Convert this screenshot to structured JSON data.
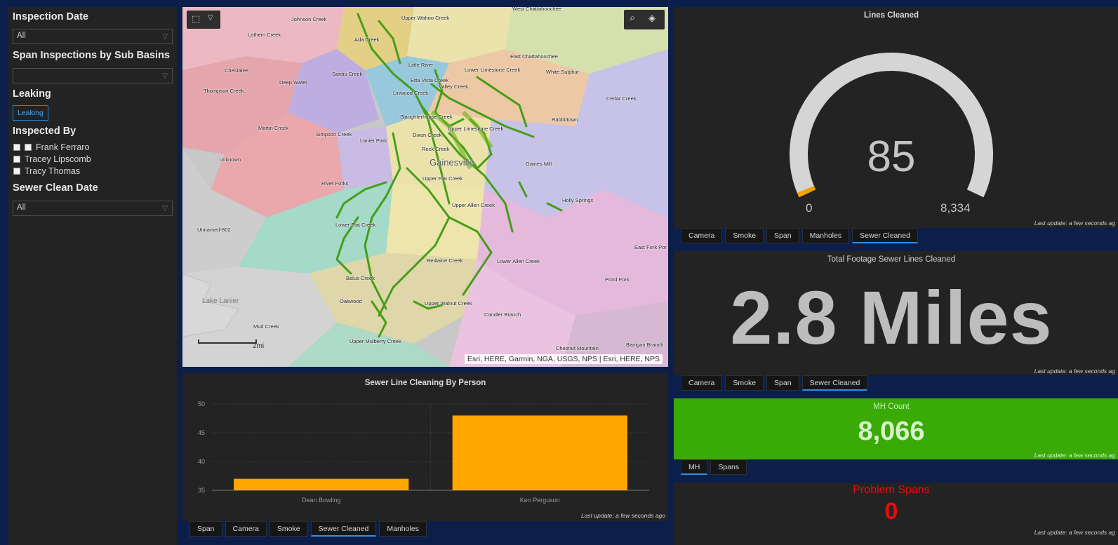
{
  "filters": {
    "inspection_date": {
      "title": "Inspection Date",
      "value": "All"
    },
    "span_inspections": {
      "title": "Span Inspections by Sub Basins",
      "value": ""
    },
    "leaking": {
      "title": "Leaking",
      "chip": "Leaking"
    },
    "inspected_by": {
      "title": "Inspected By",
      "people": [
        "Frank Ferraro",
        "Tracey Lipscomb",
        "Tracy Thomas"
      ]
    },
    "sewer_clean_date": {
      "title": "Sewer Clean Date",
      "value": "All"
    }
  },
  "map": {
    "attribution": "Esri, HERE, Garmin, NGA, USGS, NPS | Esri, HERE, NPS",
    "scale_label": "2mi",
    "city_label": "Gainesville",
    "lake_label": "Lake Lanier",
    "basin_labels": [
      "West Chattahoochee",
      "Johnson Creek",
      "Upper Wahoo Creek",
      "Lathem Creek",
      "Ada Creek",
      "East Chattahoochee",
      "Chestatee",
      "Sardis Creek",
      "Little River",
      "Lower Limestone Creek",
      "White Sulphur",
      "Deep Water",
      "Etta Vista Creek",
      "Valley Creek",
      "Thompson Creek",
      "Linwood Creek",
      "Cedar Creek",
      "Slaughterhouse Creek",
      "Rabbittown",
      "Martin Creek",
      "Upper Limestone Creek",
      "Simpson Creek",
      "Dixon Creek",
      "Lanier Park",
      "Rock Creek",
      "unknown",
      "Gaines Mill",
      "Upper Flat Creek",
      "River Forks",
      "Holly Springs",
      "Upper Allen Creek",
      "Unnamed-802",
      "Lower Flat Creek",
      "East Fork Por",
      "Redwine Creek",
      "Lower Allen Creek",
      "Balus Creek",
      "Pond Fork",
      "Oakwood",
      "Upper Walnut Creek",
      "Candler Branch",
      "Mud Creek",
      "Upper Mulberry Creek",
      "Chesnut Mountain",
      "Banigan Branch"
    ],
    "icons": {
      "toolbar_left": "select-icon",
      "toolbar_dropdown": "chevron-down-icon",
      "search": "search-icon",
      "layers": "layers-icon"
    }
  },
  "bar_chart_panel": {
    "title": "Sewer Line Cleaning By Person",
    "last_update": "Last update: a few seconds ago",
    "tabs": [
      "Span",
      "Camera",
      "Smoke",
      "Sewer Cleaned",
      "Manholes"
    ],
    "active_tab": "Sewer Cleaned"
  },
  "chart_data": {
    "type": "bar",
    "title": "Sewer Line Cleaning By Person",
    "categories": [
      "Dean Bowling",
      "Ken Perguson"
    ],
    "values": [
      37,
      48
    ],
    "ylim": [
      35,
      50
    ],
    "yticks": [
      35,
      40,
      45,
      50
    ],
    "bar_color": "#ffa600",
    "grid": true
  },
  "gauge": {
    "title": "Lines Cleaned",
    "value": "85",
    "value_num": 85,
    "min": "0",
    "min_num": 0,
    "max": "8,334",
    "max_num": 8334,
    "fill_color": "#f5a300",
    "last_update": "Last update: a few seconds ag",
    "tabs": [
      "Camera",
      "Smoke",
      "Span",
      "Manholes",
      "Sewer Cleaned"
    ],
    "active_tab": "Sewer Cleaned"
  },
  "footage": {
    "title": "Total Footage Sewer Lines Cleaned",
    "value": "2.8 Miles",
    "last_update": "Last update: a few seconds ag",
    "tabs": [
      "Camera",
      "Smoke",
      "Span",
      "Sewer Cleaned"
    ],
    "active_tab": "Sewer Cleaned"
  },
  "mh_count": {
    "label": "MH Count",
    "value": "8,066",
    "bg_color": "#3aaa06",
    "last_update": "Last update: a few seconds ag",
    "tabs": [
      "MH",
      "Spans"
    ],
    "active_tab": "MH"
  },
  "problem_spans": {
    "label": "Problem Spans",
    "value": "0",
    "color": "#e01010",
    "last_update": "Last update: a few seconds ag"
  }
}
